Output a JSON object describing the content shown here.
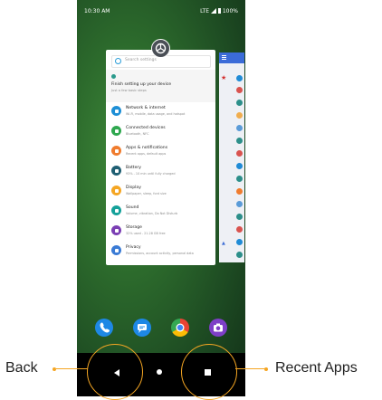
{
  "status_bar": {
    "time": "10:30 AM",
    "signal": "LTE",
    "battery": "100%"
  },
  "settings_card": {
    "search_placeholder": "Search settings",
    "finish_title": "Finish setting up your device",
    "finish_subtitle": "Just a few basic steps",
    "items": [
      {
        "title": "Network & internet",
        "subtitle": "Wi-Fi, mobile, data usage, and hotspot",
        "color": "#1e8fd6",
        "icon": "wifi-icon"
      },
      {
        "title": "Connected devices",
        "subtitle": "Bluetooth, NFC",
        "color": "#2fa84f",
        "icon": "devices-icon"
      },
      {
        "title": "Apps & notifications",
        "subtitle": "Recent apps, default apps",
        "color": "#f07c2e",
        "icon": "apps-icon"
      },
      {
        "title": "Battery",
        "subtitle": "93% - 10 min until fully charged",
        "color": "#1f5f73",
        "icon": "battery-icon"
      },
      {
        "title": "Display",
        "subtitle": "Wallpaper, sleep, font size",
        "color": "#f5a623",
        "icon": "display-icon"
      },
      {
        "title": "Sound",
        "subtitle": "Volume, vibration, Do Not Disturb",
        "color": "#15a19a",
        "icon": "sound-icon"
      },
      {
        "title": "Storage",
        "subtitle": "32% used - 21.28 GB free",
        "color": "#7b3fb4",
        "icon": "storage-icon"
      },
      {
        "title": "Privacy",
        "subtitle": "Permissions, account activity, personal data",
        "color": "#3a7bd5",
        "icon": "privacy-icon"
      }
    ]
  },
  "dock": [
    {
      "name": "phone-app",
      "color": "#1e88e5"
    },
    {
      "name": "messages-app",
      "color": "#1e88e5"
    },
    {
      "name": "chrome-app",
      "color": "#fbbc05"
    },
    {
      "name": "camera-app",
      "color": "#7e3fc7"
    }
  ],
  "callouts": {
    "back": "Back",
    "recent": "Recent Apps"
  },
  "accent_color": "#f5a623"
}
